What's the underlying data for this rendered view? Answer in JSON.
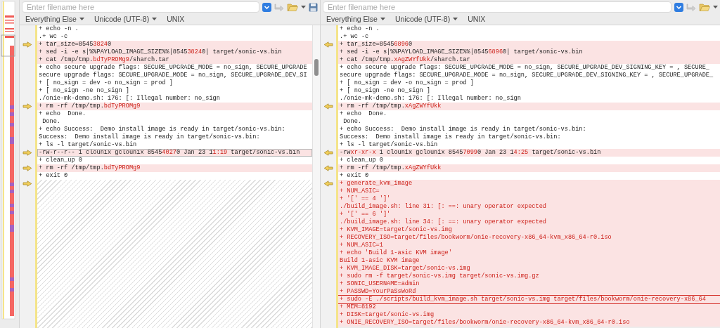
{
  "panes": [
    {
      "kind": "left",
      "filename": {
        "placeholder": "Enter filename here"
      },
      "toolbar": [
        {
          "kind": "dropdown",
          "label": "Everything Else"
        },
        {
          "kind": "dropdown",
          "label": "Unicode (UTF-8)"
        },
        {
          "kind": "label",
          "label": "UNIX"
        }
      ],
      "lines": [
        {
          "changed": false,
          "arrow": false,
          "segments": [
            {
              "text": "+ echo -n .",
              "diff": false
            }
          ]
        },
        {
          "changed": false,
          "arrow": false,
          "segments": [
            {
              "text": ".+ wc -c",
              "diff": false
            }
          ]
        },
        {
          "changed": true,
          "arrow": true,
          "segments": [
            {
              "text": "+ tar_size=8545",
              "diff": false
            },
            {
              "text": "3824",
              "diff": true
            },
            {
              "text": "0",
              "diff": false
            }
          ]
        },
        {
          "changed": true,
          "arrow": false,
          "segments": [
            {
              "text": "+ sed -i -e s|%%PAYLOAD_IMAGE_SIZE%%|8545",
              "diff": false
            },
            {
              "text": "3824",
              "diff": true
            },
            {
              "text": "0| target/sonic-vs.bin",
              "diff": false
            }
          ]
        },
        {
          "changed": true,
          "arrow": false,
          "segments": [
            {
              "text": "+ cat /tmp/tmp.",
              "diff": false
            },
            {
              "text": "bdTyPROMg9",
              "diff": true
            },
            {
              "text": "/sharch.tar",
              "diff": false
            }
          ]
        },
        {
          "changed": false,
          "arrow": false,
          "segments": [
            {
              "text": "+ echo secure upgrade flags: SECURE_UPGRADE_MODE = no_sign, SECURE_UPGRADE",
              "diff": false
            }
          ]
        },
        {
          "changed": false,
          "arrow": false,
          "segments": [
            {
              "text": "secure upgrade flags: SECURE_UPGRADE_MODE = no_sign, SECURE_UPGRADE_DEV_SI",
              "diff": false
            }
          ]
        },
        {
          "changed": false,
          "arrow": false,
          "segments": [
            {
              "text": "+ [ no_sign = dev -o no_sign = prod ]",
              "diff": false
            }
          ]
        },
        {
          "changed": false,
          "arrow": false,
          "segments": [
            {
              "text": "+ [ no_sign -ne no_sign ]",
              "diff": false
            }
          ]
        },
        {
          "changed": false,
          "arrow": false,
          "segments": [
            {
              "text": "./onie-mk-demo.sh: 176: [: Illegal number: no_sign",
              "diff": false
            }
          ]
        },
        {
          "changed": true,
          "arrow": true,
          "segments": [
            {
              "text": "+ rm -rf /tmp/tmp.",
              "diff": false
            },
            {
              "text": "bdTyPROMg9",
              "diff": true
            }
          ]
        },
        {
          "changed": false,
          "arrow": false,
          "segments": [
            {
              "text": "+ echo  Done.",
              "diff": false
            }
          ]
        },
        {
          "changed": false,
          "arrow": false,
          "segments": [
            {
              "text": " Done.",
              "diff": false
            }
          ]
        },
        {
          "changed": false,
          "arrow": false,
          "segments": [
            {
              "text": "+ echo Success:  Demo install image is ready in target/sonic-vs.bin:",
              "diff": false
            }
          ]
        },
        {
          "changed": false,
          "arrow": false,
          "segments": [
            {
              "text": "Success:  Demo install image is ready in target/sonic-vs.bin:",
              "diff": false
            }
          ]
        },
        {
          "changed": false,
          "arrow": false,
          "segments": [
            {
              "text": "+ ls -l target/sonic-vs.bin",
              "diff": false
            }
          ]
        },
        {
          "changed": true,
          "arrow": true,
          "focused": true,
          "segments": [
            {
              "text": "-rw-r--r-- 1 clounix gclounix 8545",
              "diff": false
            },
            {
              "text": "4027",
              "diff": true
            },
            {
              "text": "0 Jan 23 1",
              "diff": false
            },
            {
              "text": "1:19",
              "diff": true
            },
            {
              "text": " target/sonic-vs.bin",
              "diff": false
            }
          ]
        },
        {
          "changed": false,
          "arrow": false,
          "segments": [
            {
              "text": "+ clean_up 0",
              "diff": false
            }
          ]
        },
        {
          "changed": true,
          "arrow": true,
          "segments": [
            {
              "text": "+ rm -rf /tmp/tmp.",
              "diff": false
            },
            {
              "text": "bdTyPROMg9",
              "diff": true
            }
          ]
        },
        {
          "changed": false,
          "arrow": false,
          "segments": [
            {
              "text": "+ exit 0",
              "diff": false
            }
          ]
        }
      ],
      "gap": {
        "kind": "hatched",
        "arrow": true
      }
    },
    {
      "kind": "right",
      "filename": {
        "placeholder": "Enter filename here"
      },
      "toolbar": [
        {
          "kind": "dropdown",
          "label": "Everything Else"
        },
        {
          "kind": "dropdown",
          "label": "Unicode (UTF-8)"
        },
        {
          "kind": "label",
          "label": "UNIX"
        }
      ],
      "lines": [
        {
          "changed": false,
          "arrow": false,
          "segments": [
            {
              "text": "+ echo -n .",
              "diff": false
            }
          ]
        },
        {
          "changed": false,
          "arrow": false,
          "segments": [
            {
              "text": ".+ wc -c",
              "diff": false
            }
          ]
        },
        {
          "changed": true,
          "arrow": true,
          "segments": [
            {
              "text": "+ tar_size=8545",
              "diff": false
            },
            {
              "text": "6896",
              "diff": true
            },
            {
              "text": "0",
              "diff": false
            }
          ]
        },
        {
          "changed": true,
          "arrow": false,
          "segments": [
            {
              "text": "+ sed -i -e s|%%PAYLOAD_IMAGE_SIZE%%|8545",
              "diff": false
            },
            {
              "text": "6896",
              "diff": true
            },
            {
              "text": "0| target/sonic-vs.bin",
              "diff": false
            }
          ]
        },
        {
          "changed": true,
          "arrow": false,
          "segments": [
            {
              "text": "+ cat /tmp/tmp.",
              "diff": false
            },
            {
              "text": "xAgZWYfUkk",
              "diff": true
            },
            {
              "text": "/sharch.tar",
              "diff": false
            }
          ]
        },
        {
          "changed": false,
          "arrow": false,
          "segments": [
            {
              "text": "+ echo secure upgrade flags: SECURE_UPGRADE_MODE = no_sign, SECURE_UPGRADE_DEV_SIGNING_KEY = , SECURE_",
              "diff": false
            }
          ]
        },
        {
          "changed": false,
          "arrow": false,
          "segments": [
            {
              "text": "secure upgrade flags: SECURE_UPGRADE_MODE = no_sign, SECURE_UPGRADE_DEV_SIGNING_KEY = , SECURE_UPGRADE_",
              "diff": false
            }
          ]
        },
        {
          "changed": false,
          "arrow": false,
          "segments": [
            {
              "text": "+ [ no_sign = dev -o no_sign = prod ]",
              "diff": false
            }
          ]
        },
        {
          "changed": false,
          "arrow": false,
          "segments": [
            {
              "text": "+ [ no_sign -ne no_sign ]",
              "diff": false
            }
          ]
        },
        {
          "changed": false,
          "arrow": false,
          "segments": [
            {
              "text": "./onie-mk-demo.sh: 176: [: Illegal number: no_sign",
              "diff": false
            }
          ]
        },
        {
          "changed": true,
          "arrow": true,
          "segments": [
            {
              "text": "+ rm -rf /tmp/tmp.",
              "diff": false
            },
            {
              "text": "xAgZWYfUkk",
              "diff": true
            }
          ]
        },
        {
          "changed": false,
          "arrow": false,
          "segments": [
            {
              "text": "+ echo  Done.",
              "diff": false
            }
          ]
        },
        {
          "changed": false,
          "arrow": false,
          "segments": [
            {
              "text": " Done.",
              "diff": false
            }
          ]
        },
        {
          "changed": false,
          "arrow": false,
          "segments": [
            {
              "text": "+ echo Success:  Demo install image is ready in target/sonic-vs.bin:",
              "diff": false
            }
          ]
        },
        {
          "changed": false,
          "arrow": false,
          "segments": [
            {
              "text": "Success:  Demo install image is ready in target/sonic-vs.bin:",
              "diff": false
            }
          ]
        },
        {
          "changed": false,
          "arrow": false,
          "segments": [
            {
              "text": "+ ls -l target/sonic-vs.bin",
              "diff": false
            }
          ]
        },
        {
          "changed": true,
          "arrow": true,
          "segments": [
            {
              "text": "-rw",
              "diff": false
            },
            {
              "text": "xr-xr-x",
              "diff": true
            },
            {
              "text": " 1 clounix gclounix 8545",
              "diff": false
            },
            {
              "text": "7099",
              "diff": true
            },
            {
              "text": "0 Jan 23 1",
              "diff": false
            },
            {
              "text": "4:25",
              "diff": true
            },
            {
              "text": " target/sonic-vs.bin",
              "diff": false
            }
          ]
        },
        {
          "changed": false,
          "arrow": false,
          "segments": [
            {
              "text": "+ clean_up 0",
              "diff": false
            }
          ]
        },
        {
          "changed": true,
          "arrow": true,
          "segments": [
            {
              "text": "+ rm -rf /tmp/tmp.",
              "diff": false
            },
            {
              "text": "xAgZWYfUkk",
              "diff": true
            }
          ]
        },
        {
          "changed": false,
          "arrow": false,
          "segments": [
            {
              "text": "+ exit 0",
              "diff": false
            }
          ]
        },
        {
          "changed": true,
          "arrow": true,
          "segments": [
            {
              "text": "+ generate_kvm_image",
              "diff": true
            }
          ]
        },
        {
          "changed": true,
          "arrow": false,
          "segments": [
            {
              "text": "+ NUM_ASIC=",
              "diff": true
            }
          ]
        },
        {
          "changed": true,
          "arrow": false,
          "segments": [
            {
              "text": "+ '[' == 4 ']'",
              "diff": true
            }
          ]
        },
        {
          "changed": true,
          "arrow": false,
          "segments": [
            {
              "text": "./build_image.sh: line 31: [: ==: unary operator expected",
              "diff": true
            }
          ]
        },
        {
          "changed": true,
          "arrow": false,
          "segments": [
            {
              "text": "+ '[' == 6 ']'",
              "diff": true
            }
          ]
        },
        {
          "changed": true,
          "arrow": false,
          "segments": [
            {
              "text": "./build_image.sh: line 34: [: ==: unary operator expected",
              "diff": true
            }
          ]
        },
        {
          "changed": true,
          "arrow": false,
          "segments": [
            {
              "text": "+ KVM_IMAGE=target/sonic-vs.img",
              "diff": true
            }
          ]
        },
        {
          "changed": true,
          "arrow": false,
          "segments": [
            {
              "text": "+ RECOVERY_ISO=target/files/bookworm/onie-recovery-x86_64-kvm_x86_64-r0.iso",
              "diff": true
            }
          ]
        },
        {
          "changed": true,
          "arrow": false,
          "segments": [
            {
              "text": "+ NUM_ASIC=1",
              "diff": true
            }
          ]
        },
        {
          "changed": true,
          "arrow": false,
          "segments": [
            {
              "text": "+ echo 'Build 1-asic KVM image'",
              "diff": true
            }
          ]
        },
        {
          "changed": true,
          "arrow": false,
          "segments": [
            {
              "text": "Build 1-asic KVM image",
              "diff": true
            }
          ]
        },
        {
          "changed": true,
          "arrow": false,
          "segments": [
            {
              "text": "+ KVM_IMAGE_DISK=target/sonic-vs.img",
              "diff": true
            }
          ]
        },
        {
          "changed": true,
          "arrow": false,
          "segments": [
            {
              "text": "+ sudo rm -f target/sonic-vs.img target/sonic-vs.img.gz",
              "diff": true
            }
          ]
        },
        {
          "changed": true,
          "arrow": false,
          "segments": [
            {
              "text": "+ SONIC_USERNAME=admin",
              "diff": true
            }
          ]
        },
        {
          "changed": true,
          "arrow": false,
          "segments": [
            {
              "text": "+ PASSWD=YourPaSsWoRd",
              "diff": true
            }
          ]
        },
        {
          "changed": true,
          "arrow": false,
          "highlighted": true,
          "segments": [
            {
              "text": "+ sudo -E ./scripts/build_kvm_image.sh target/sonic-vs.img target/files/bookworm/onie-recovery-x86_64",
              "diff": true
            }
          ]
        },
        {
          "changed": true,
          "arrow": false,
          "segments": [
            {
              "text": "+ MEM=8192",
              "diff": true
            }
          ]
        },
        {
          "changed": true,
          "arrow": false,
          "segments": [
            {
              "text": "+ DISK=target/sonic-vs.img",
              "diff": true
            }
          ]
        },
        {
          "changed": true,
          "arrow": false,
          "segments": [
            {
              "text": "+ ONIE_RECOVERY_ISO=target/files/bookworm/onie-recovery-x86_64-kvm_x86_64-r0.iso",
              "diff": true
            }
          ]
        }
      ]
    }
  ]
}
